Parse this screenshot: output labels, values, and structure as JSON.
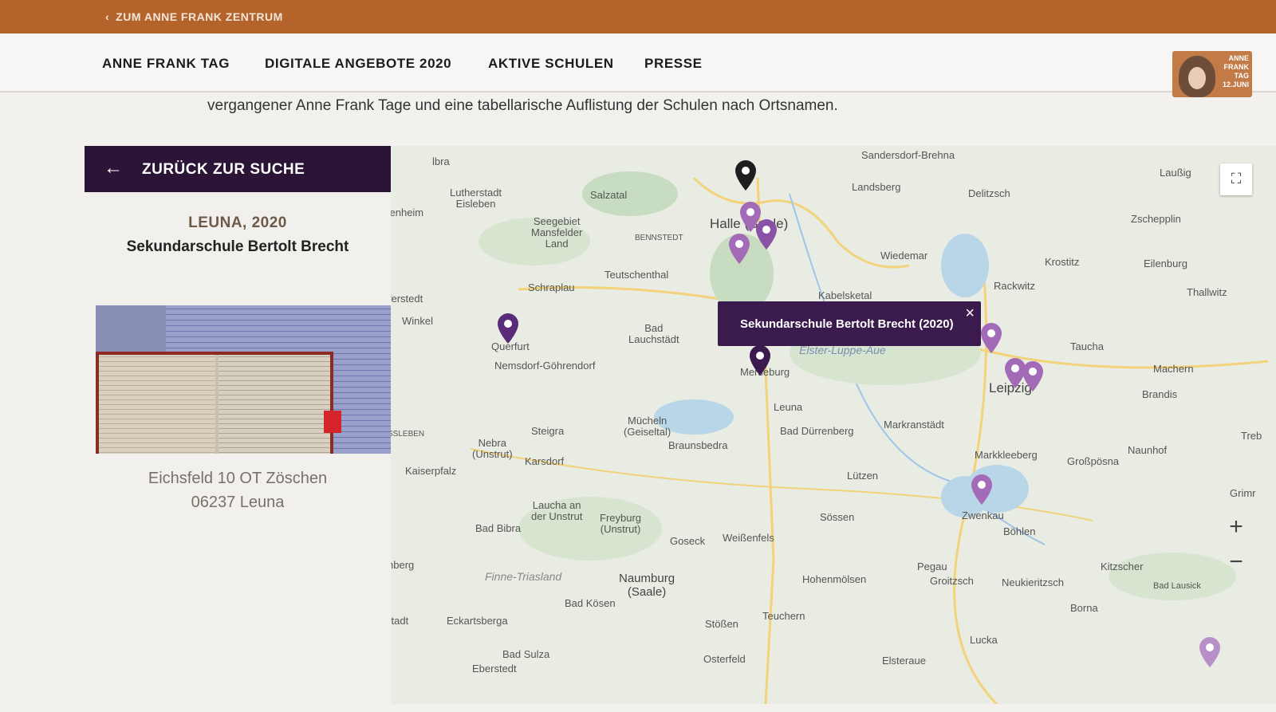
{
  "topbar": {
    "back_label": "ZUM ANNE FRANK ZENTRUM"
  },
  "nav": {
    "items": [
      "ANNE FRANK TAG",
      "DIGITALE ANGEBOTE 2020",
      "AKTIVE SCHULEN",
      "PRESSE"
    ]
  },
  "logo": {
    "lines": [
      "ANNE",
      "FRANK",
      "TAG",
      "12.JUNI"
    ]
  },
  "intro": {
    "text": "vergangener Anne Frank Tage und eine tabellarische Auflistung der Schulen nach Ortsnamen."
  },
  "panel": {
    "back_label": "ZURÜCK ZUR SUCHE",
    "city": "LEUNA, 2020",
    "school": "Sekundarschule Bertolt Brecht",
    "address_line1": "Eichsfeld 10 OT Zöschen",
    "address_line2": "06237 Leuna"
  },
  "map": {
    "popup": "Sekundarschule Bertolt Brecht (2020)",
    "towns": {
      "sandersdorf": "Sandersdorf-Brehna",
      "landsberg": "Landsberg",
      "delitzsch": "Delitzsch",
      "laussig": "Laußig",
      "lutherstadt": "Lutherstadt\nEisleben",
      "salzatal": "Salzatal",
      "seegebiet": "Seegebiet\nMansfelder\nLand",
      "bennstedt": "BENNSTEDT",
      "halle": "Halle (Saale)",
      "wiedemar": "Wiedemar",
      "krostitz": "Krostitz",
      "eilenburg": "Eilenburg",
      "zschepplin": "Zschepplin",
      "schraplau": "Schraplau",
      "teutschenthal": "Teutschenthal",
      "kabelsketal": "Kabelsketal",
      "rackwitz": "Rackwitz",
      "thallwitz": "Thallwitz",
      "winkel": "Winkel",
      "querfurt": "Querfurt",
      "bad_lauchstaedt": "Bad\nLauchstädt",
      "taucha": "Taucha",
      "nemsdorf": "Nemsdorf-Göhrendorf",
      "merseburg": "Merseburg",
      "leipzig": "Leipzig",
      "machern": "Machern",
      "brandis": "Brandis",
      "leuna": "Leuna",
      "steigra": "Steigra",
      "muecheln": "Mücheln\n(Geiseltal)",
      "bad_duerrenberg": "Bad Dürrenberg",
      "markranstaedt": "Markranstädt",
      "nebra": "Nebra\n(Unstrut)",
      "braunsbedra": "Braunsbedra",
      "karsdorf": "Karsdorf",
      "kaiserpfalz": "Kaiserpfalz",
      "markkleeberg": "Markkleeberg",
      "grosspoesna": "Großpösna",
      "naunhof": "Naunhof",
      "luetzen": "Lützen",
      "laucha": "Laucha an\nder Unstrut",
      "freyburg": "Freyburg\n(Unstrut)",
      "bad_bibra": "Bad Bibra",
      "goseck": "Goseck",
      "weissenfels": "Weißenfels",
      "soessen": "Sössen",
      "zwenkau": "Zwenkau",
      "boehlen": "Böhlen",
      "finne": "Finne-Triasland",
      "naumburg": "Naumburg\n(Saale)",
      "hohenmoelsen": "Hohenmölsen",
      "pegau": "Pegau",
      "groitzsch": "Groitzsch",
      "neukieritzsch": "Neukieritzsch",
      "kitzscher": "Kitzscher",
      "bad_lausick": "Bad Lausick",
      "bad_koesen": "Bad Kösen",
      "eckartsberga": "Eckartsberga",
      "teuchern": "Teuchern",
      "stoessen": "Stößen",
      "borna": "Borna",
      "bad_sulza": "Bad Sulza",
      "eberstedt": "Eberstedt",
      "osterfeld": "Osterfeld",
      "elsteraue": "Elsteraue",
      "lucka": "Lucka",
      "grimma": "Grimr",
      "trebsen": "Treb",
      "ibra": "lbra",
      "kenheim": "kenheim",
      "ferstedt": "lferstedt",
      "ssleben": "SSLEBEN",
      "nberg": "nberg",
      "stadt": "stadt",
      "elster": "Elster-Luppe-Aue"
    }
  }
}
